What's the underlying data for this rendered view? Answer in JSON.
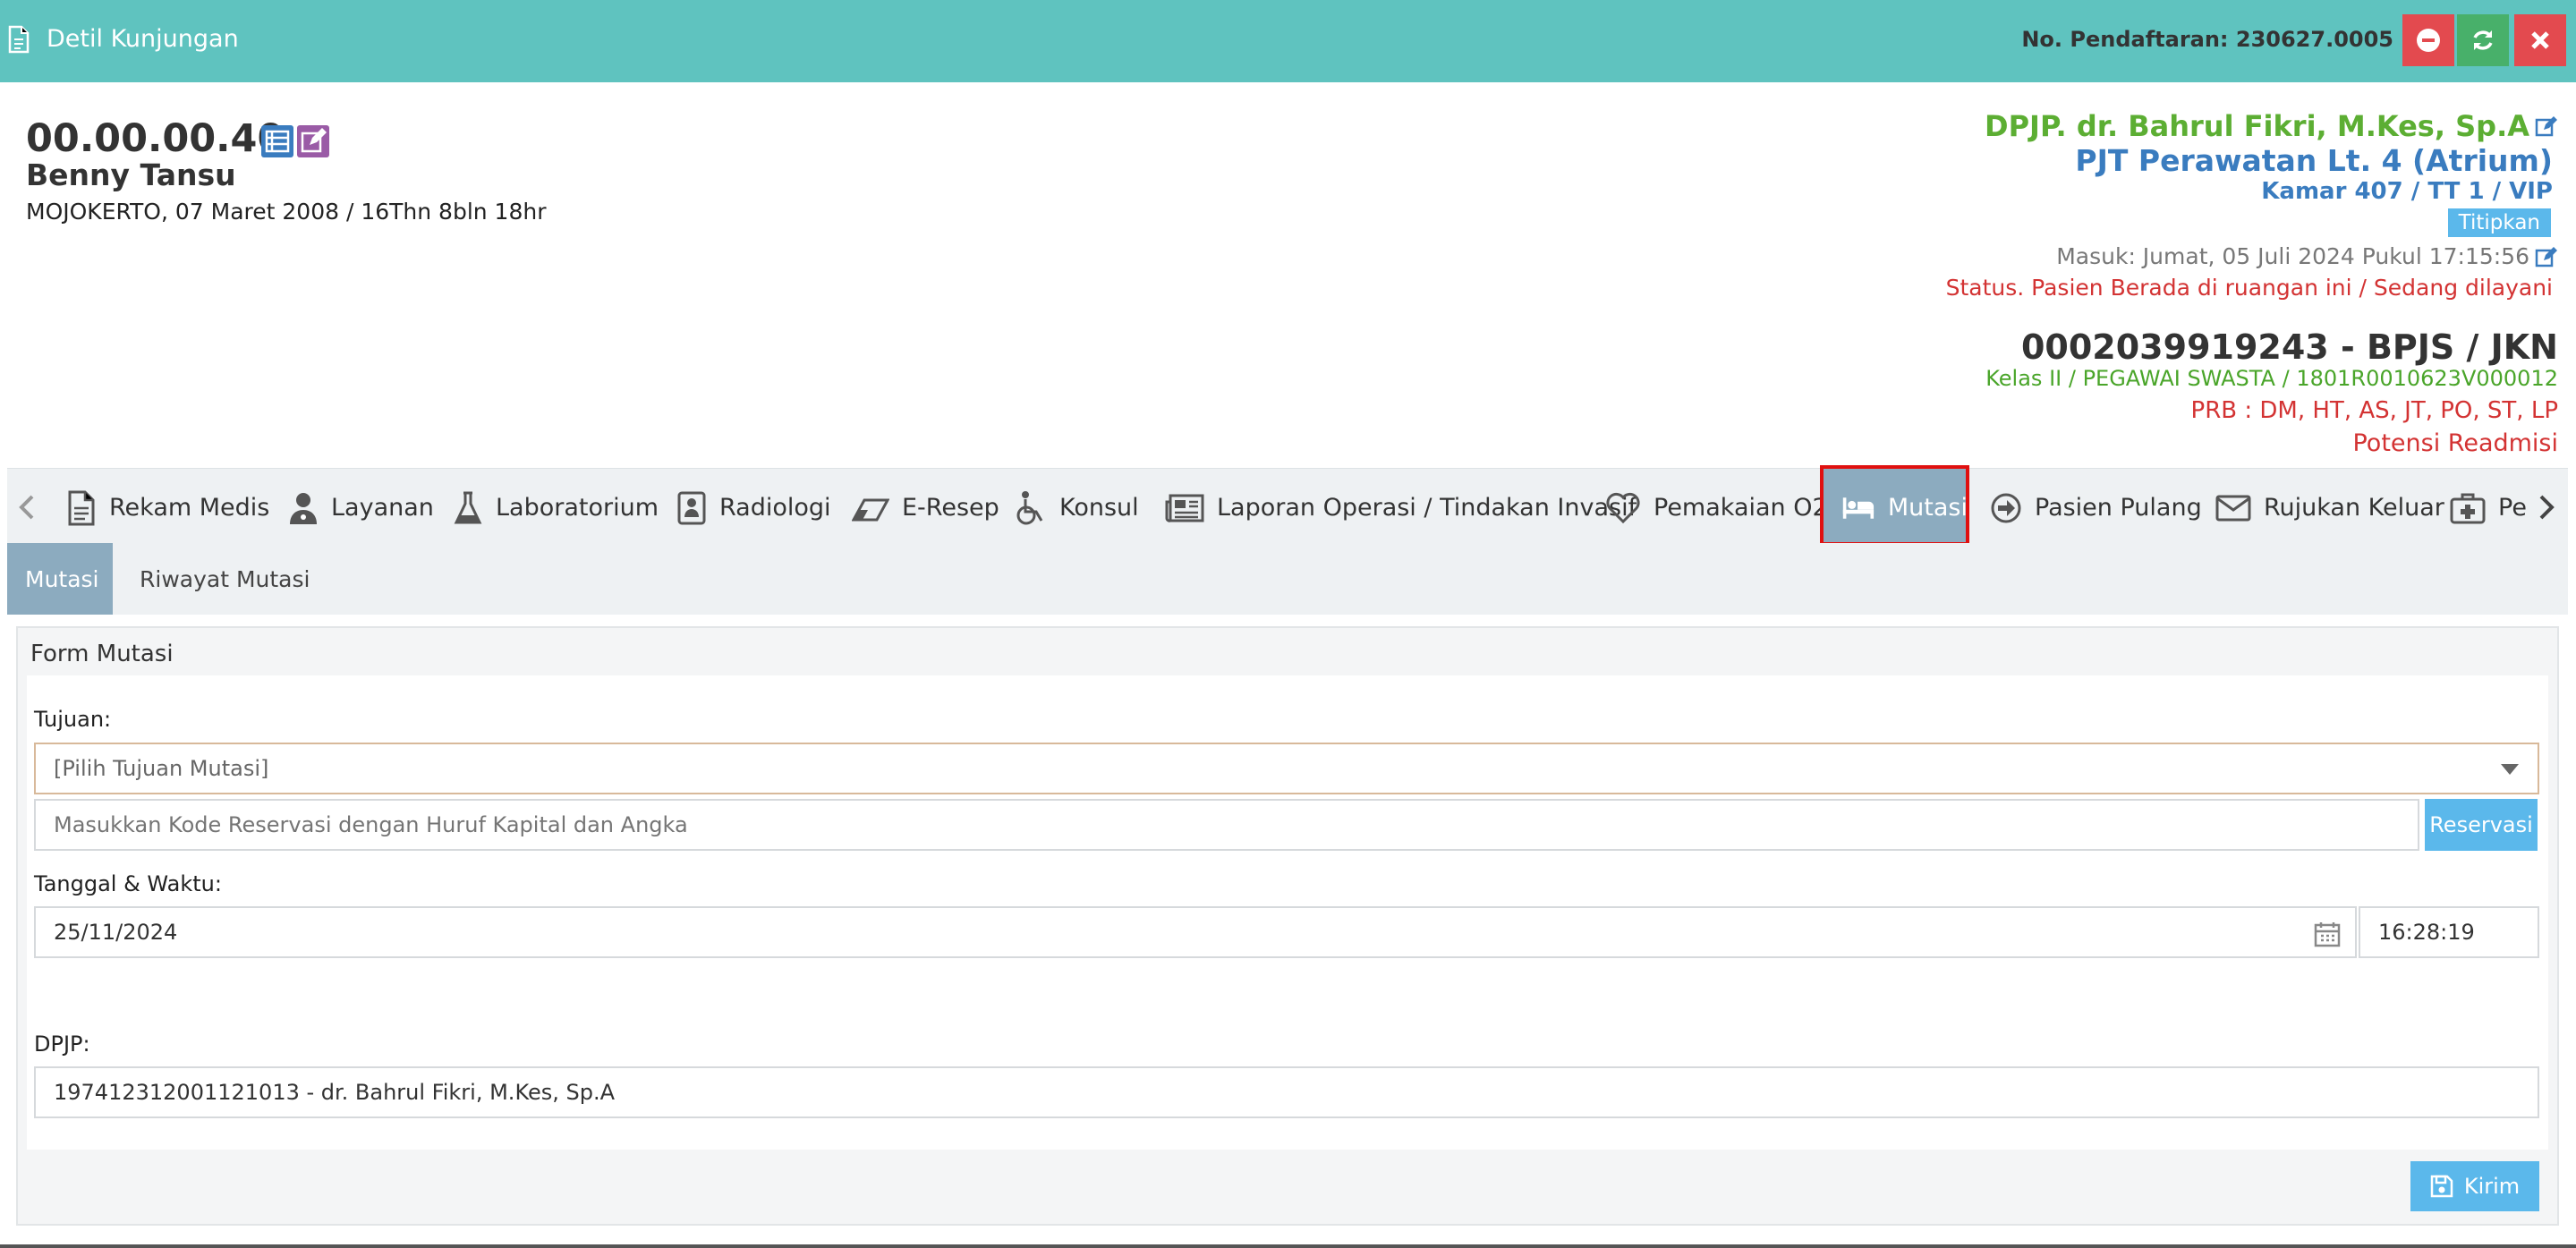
{
  "header": {
    "title": "Detil Kunjungan",
    "registration": "No. Pendaftaran: 230627.0005",
    "bg_color": "#5fc3bf"
  },
  "patient": {
    "id": "00.00.00.40",
    "name": "Benny Tansu",
    "birth": "MOJOKERTO, 07 Maret 2008 / 16Thn 8bln 18hr"
  },
  "visit": {
    "dpjp": "DPJP. dr. Bahrul Fikri, M.Kes, Sp.A",
    "pjt": "PJT Perawatan Lt. 4 (Atrium)",
    "room": "Kamar 407 / TT 1 / VIP",
    "badge": "Titipkan",
    "admission": "Masuk: Jumat, 05 Juli 2024 Pukul 17:15:56",
    "status": "Status. Pasien Berada di ruangan ini / Sedang dilayani",
    "insurance": "0002039919243 - BPJS / JKN",
    "class": "Kelas II / PEGAWAI SWASTA / 1801R0010623V000012",
    "prb": "PRB : DM, HT, AS, JT, PO, ST, LP",
    "readmission": "Potensi Readmisi"
  },
  "tabs": [
    {
      "label": "Rekam Medis",
      "icon": "file-icon"
    },
    {
      "label": "Layanan",
      "icon": "user-md-icon"
    },
    {
      "label": "Laboratorium",
      "icon": "flask-icon"
    },
    {
      "label": "Radiologi",
      "icon": "xray-icon"
    },
    {
      "label": "E-Resep",
      "icon": "eraser-icon"
    },
    {
      "label": "Konsul",
      "icon": "wheelchair-icon"
    },
    {
      "label": "Laporan Operasi / Tindakan Invasif",
      "icon": "newspaper-icon"
    },
    {
      "label": "Pemakaian O2",
      "icon": "heart-icon"
    },
    {
      "label": "Mutasi",
      "icon": "bed-icon"
    },
    {
      "label": "Pasien Pulang",
      "icon": "arrow-circle-icon"
    },
    {
      "label": "Rujukan Keluar",
      "icon": "envelope-icon"
    },
    {
      "label": "Pe",
      "icon": "medkit-icon"
    }
  ],
  "subtabs": [
    "Mutasi",
    "Riwayat Mutasi"
  ],
  "form": {
    "title": "Form Mutasi",
    "tujuan_label": "Tujuan:",
    "tujuan_placeholder": "[Pilih Tujuan Mutasi]",
    "reservation_placeholder": "Masukkan Kode Reservasi dengan Huruf Kapital dan Angka",
    "reservation_button": "Reservasi",
    "datetime_label": "Tanggal & Waktu:",
    "date": "25/11/2024",
    "time": "16:28:19",
    "dpjp_label": "DPJP:",
    "dpjp_value": "197412312001121013 - dr. Bahrul Fikri, M.Kes, Sp.A",
    "submit": "Kirim"
  }
}
